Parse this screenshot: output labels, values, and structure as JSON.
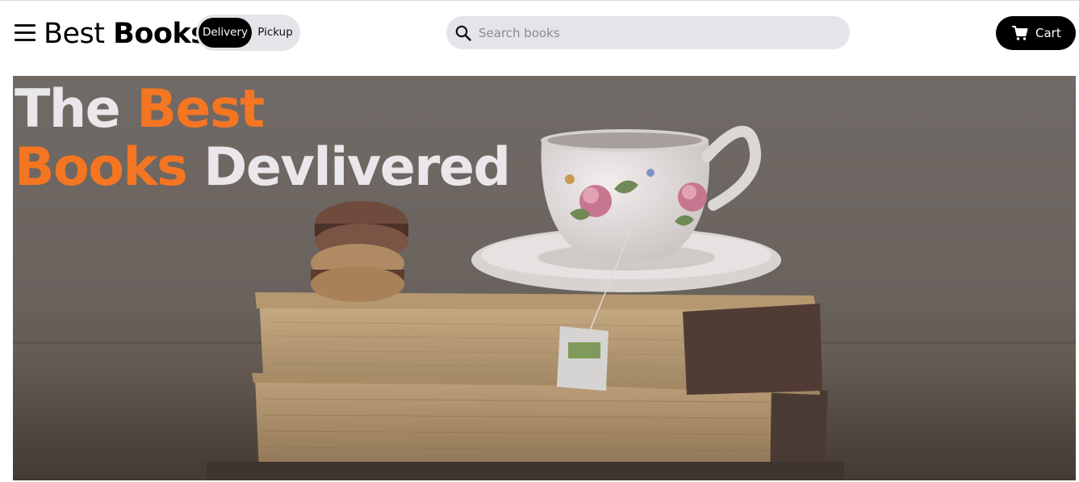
{
  "nav": {
    "logo_regular": "Best",
    "logo_bold": "Books",
    "mode_options": [
      "Delivery",
      "Pickup"
    ],
    "selected_mode": "Delivery",
    "search_placeholder": "Search books",
    "cart_label": "Cart",
    "icons": {
      "menu": "hamburger-menu-icon",
      "search": "search-icon",
      "cart": "cart-icon"
    }
  },
  "hero": {
    "title_words": [
      "The",
      "Best",
      "Books",
      "Devlivered"
    ],
    "image": "stack-of-old-books-with-teacup-and-macarons"
  },
  "colors": {
    "accent": "#f47622",
    "title_light": "#e9e7ea",
    "button_dark": "#000000",
    "pill_background": "#e5e5e9"
  }
}
